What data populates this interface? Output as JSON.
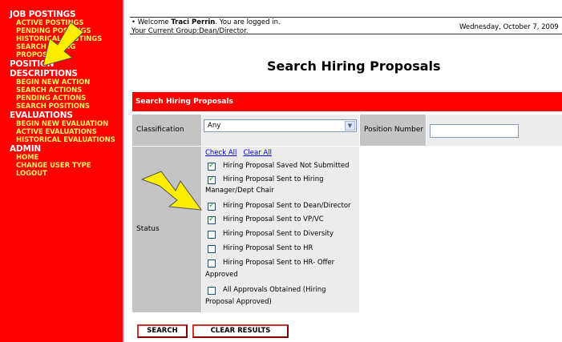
{
  "sidebar": {
    "sections": [
      {
        "title": "JOB POSTINGS",
        "items": [
          "ACTIVE POSTINGS",
          "PENDING POSTINGS",
          "HISTORICAL POSTINGS",
          "SEARCH HIRING",
          "PROPOSALS"
        ]
      },
      {
        "title": "POSITION DESCRIPTIONS",
        "items": [
          "BEGIN NEW ACTION",
          "SEARCH ACTIONS",
          "PENDING ACTIONS",
          "SEARCH POSITIONS"
        ]
      },
      {
        "title": "EVALUATIONS",
        "items": [
          "BEGIN NEW EVALUATION",
          "ACTIVE EVALUATIONS",
          "HISTORICAL EVALUATIONS"
        ]
      },
      {
        "title": "ADMIN",
        "items": [
          "HOME",
          "CHANGE USER TYPE",
          "LOGOUT"
        ]
      }
    ]
  },
  "header": {
    "welcome_prefix": "• Welcome ",
    "user_name": "Traci Perrin",
    "welcome_suffix": ". You are logged in.",
    "group": "Your Current Group:Dean/Director.",
    "date": "Wednesday, October 7, 2009"
  },
  "page_title": "Search Hiring Proposals",
  "form": {
    "header": "Search Hiring Proposals",
    "classification_label": "Classification Title",
    "classification_value": "Any",
    "position_number_label": "Position Number",
    "position_number_value": "",
    "status_label": "Status",
    "check_all": "Check All",
    "clear_all": "Clear All",
    "statuses": [
      {
        "line1": "Hiring Proposal Saved Not Submitted",
        "line2": "",
        "checked": true
      },
      {
        "line1": "Hiring Proposal Sent to Hiring",
        "line2": "Manager/Dept Chair",
        "checked": true
      },
      {
        "line1": "Hiring Proposal Sent to Dean/Director",
        "line2": "",
        "checked": true
      },
      {
        "line1": "Hiring Proposal Sent to VP/VC",
        "line2": "",
        "checked": true
      },
      {
        "line1": "Hiring Proposal Sent to Diversity",
        "line2": "",
        "checked": false
      },
      {
        "line1": "Hiring Proposal Sent to HR",
        "line2": "",
        "checked": false
      },
      {
        "line1": "Hiring Proposal Sent to HR- Offer",
        "line2": "Approved",
        "checked": false
      },
      {
        "line1": "All Approvals Obtained (Hiring",
        "line2": "Proposal Approved)",
        "checked": false
      }
    ],
    "search_button": "SEARCH",
    "clear_button": "CLEAR RESULTS"
  },
  "colors": {
    "sidebar_bg": "#ff0000",
    "sidebar_section": "#ffffff",
    "sidebar_item": "#ffee66",
    "form_header": "#ff0000",
    "annotation_arrow": "#ffee00"
  }
}
